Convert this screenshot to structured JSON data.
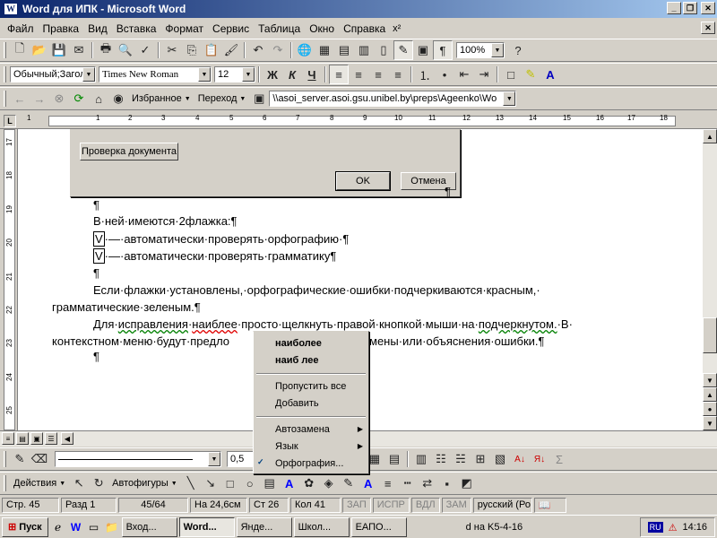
{
  "window": {
    "title": "Word для  ИПК - Microsoft Word",
    "app_icon": "W"
  },
  "menu": {
    "items": [
      "Файл",
      "Правка",
      "Вид",
      "Вставка",
      "Формат",
      "Сервис",
      "Таблица",
      "Окно",
      "Справка"
    ],
    "extra": "x²"
  },
  "standard_toolbar": {
    "zoom": "100%"
  },
  "format_toolbar": {
    "style": "Обычный;Загол",
    "font": "Times New Roman",
    "size": "12",
    "bold": "Ж",
    "italic": "К",
    "underline": "Ч"
  },
  "web_toolbar": {
    "favorites": "Избранное",
    "goto": "Переход",
    "address": "\\\\asoi_server.asoi.gsu.unibel.by\\preps\\Ageenko\\Wo"
  },
  "ruler": {
    "numbers": [
      "1",
      "1",
      "2",
      "3",
      "4",
      "5",
      "6",
      "7",
      "8",
      "9",
      "10",
      "11",
      "12",
      "13",
      "14",
      "15",
      "16",
      "17",
      "18"
    ]
  },
  "vruler": {
    "numbers": [
      "17",
      "18",
      "19",
      "20",
      "21",
      "22",
      "23",
      "24",
      "25"
    ]
  },
  "dialog": {
    "check_doc": "Проверка документа",
    "ok": "OK",
    "cancel": "Отмена"
  },
  "document": {
    "pilcrow": "¶",
    "line1": "В·ней·имеются·2флажка:¶",
    "check_mark": "V",
    "line2_rest": "·—·автоматически·проверять·орфографию·¶",
    "line3_rest": "·—·автоматически·проверять·грамматику¶",
    "line4": "Если·флажки·установлены,·орфографические·ошибки·подчеркиваются·красным,·",
    "line5": "грамматические·зеленым.¶",
    "line6_a": "Для·",
    "line6_b": "исправления",
    "line6_c": "·",
    "line6_d": "наиблее",
    "line6_e": "·просто·щелкнуть·правой·кнопкой·мыши·на·",
    "line6_f": "подчеркнутом.",
    "line6_g": "·В·",
    "line7_a": "контекстном·меню·будут·предло",
    "line7_b": "мены·или·объяснения·ошибки.¶"
  },
  "context_menu": {
    "suggestion1": "наиболее",
    "suggestion2": "наиб лее",
    "ignore_all": "Пропустить все",
    "add": "Добавить",
    "autocorrect": "Автозамена",
    "language": "Язык",
    "spelling": "Орфография..."
  },
  "drawing_toolbar": {
    "line_width": "0,5",
    "actions": "Действия",
    "autoshapes": "Автофигуры"
  },
  "statusbar": {
    "page": "Стр.  45",
    "section": "Разд  1",
    "pages": "45/64",
    "at": "На 24,6см",
    "line": "Ст  26",
    "col": "Кол  41",
    "rec": "ЗАП",
    "trk": "ИСПР",
    "ext": "ВДЛ",
    "ovr": "ЗАМ",
    "language": "русский (Ро"
  },
  "taskbar": {
    "start": "Пуск",
    "tasks": [
      "Вход...",
      "Word...",
      "Янде...",
      "Школ...",
      "ЕАПО..."
    ],
    "extra": "d на K5-4-16",
    "lang": "RU",
    "clock": "14:16"
  }
}
